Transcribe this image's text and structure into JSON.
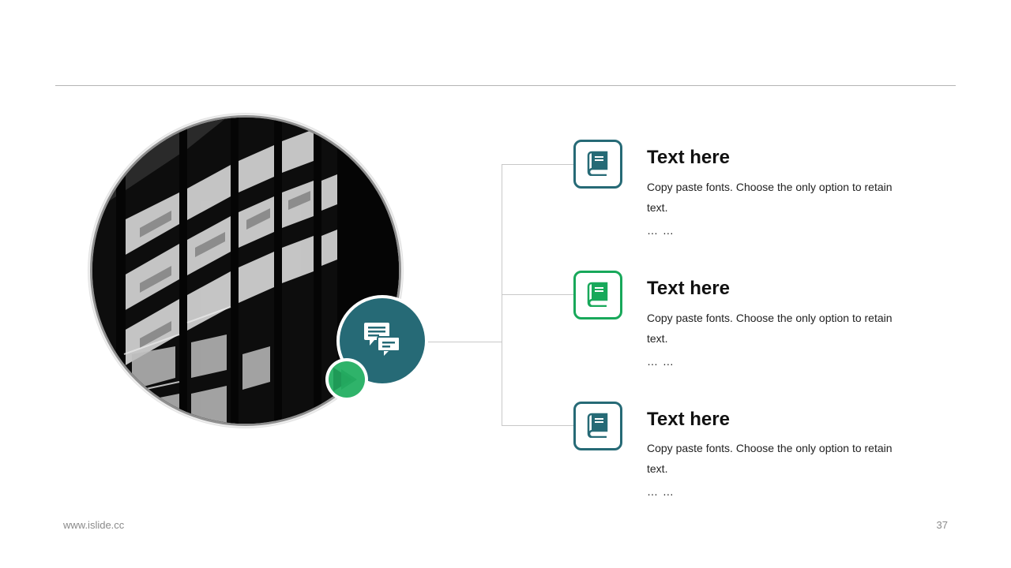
{
  "slide": {
    "page_number": "37",
    "footer_site": "www.islide.cc"
  },
  "hero": {
    "image_icon": "building-photo",
    "badge_icon": "chat-bubbles-icon",
    "accent_icon": "play-icon"
  },
  "items": [
    {
      "title": "Text here",
      "desc": "Copy paste fonts. Choose the only option to retain text.",
      "more": "… …",
      "icon": "book-icon",
      "color": "#266a76"
    },
    {
      "title": "Text here",
      "desc": "Copy paste fonts. Choose the only option to retain text.",
      "more": "… …",
      "icon": "book-icon",
      "color": "#18a85a"
    },
    {
      "title": "Text here",
      "desc": "Copy paste fonts. Choose the only option to retain text.",
      "more": "… …",
      "icon": "book-icon",
      "color": "#266a76"
    }
  ],
  "colors": {
    "teal": "#266a76",
    "green": "#18a85a",
    "rule": "#b4b4b4"
  }
}
